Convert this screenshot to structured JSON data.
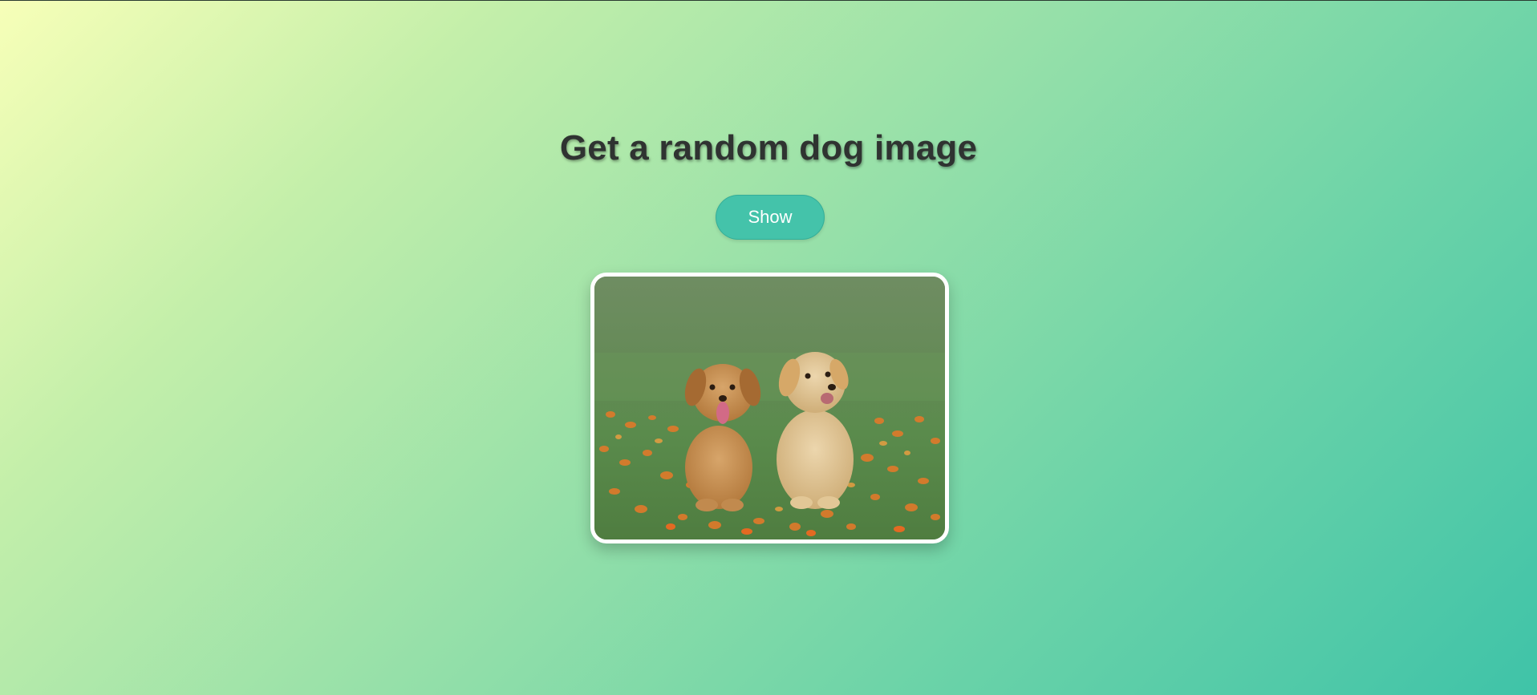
{
  "header": {
    "title": "Get a random dog image"
  },
  "controls": {
    "show_label": "Show"
  },
  "image": {
    "icon": "dog-photo",
    "alt": "Two golden retriever puppies sitting in grass with orange flowers"
  },
  "colors": {
    "accent": "#44c3aa",
    "title_text": "#2f3331",
    "gradient_start": "#f7ffb8",
    "gradient_end": "#3fc3a8"
  }
}
